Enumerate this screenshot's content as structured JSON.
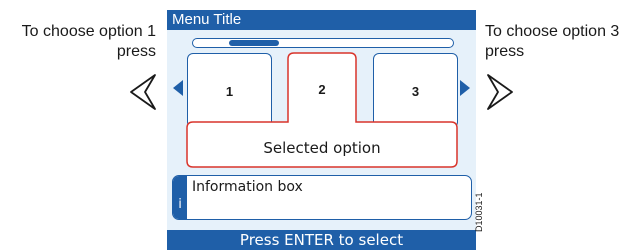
{
  "annotations": {
    "left": {
      "line1": "To choose option 1",
      "line2": "press"
    },
    "right": {
      "line1": "To choose option 3",
      "line2": "press"
    }
  },
  "screen": {
    "title": "Menu Title",
    "options": [
      "1",
      "2",
      "3"
    ],
    "selected_option": "2",
    "selected_label": "Selected option",
    "info_icon": "i",
    "info_text": "Information box",
    "footer": "Press ENTER to select"
  },
  "figure_id": "D10031-1",
  "colors": {
    "accent": "#1f5fa8",
    "screen_background": "#e6f1fa",
    "selection": "#d9342b"
  }
}
